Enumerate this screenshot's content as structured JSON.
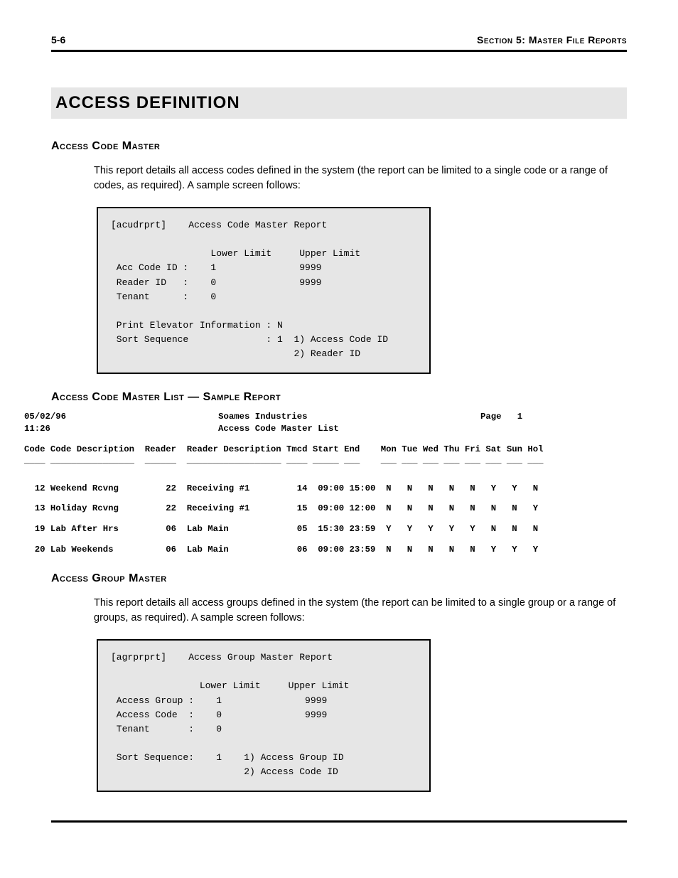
{
  "header": {
    "page_num": "5-6",
    "section_label": "Section 5: Master File Reports"
  },
  "title": "ACCESS DEFINITION",
  "sec1": {
    "heading": "Access Code Master",
    "text": "This report details all access codes defined in the system (the report can be limited to a single code or a range of codes, as required).  A sample screen follows:"
  },
  "screen1": {
    "l1": "[acudrprt]    Access Code Master Report",
    "l2": "",
    "l3": "                  Lower Limit     Upper Limit",
    "l4": " Acc Code ID :    1               9999",
    "l5": " Reader ID   :    0               9999",
    "l6": " Tenant      :    0",
    "l7": "",
    "l8": " Print Elevator Information : N",
    "l9": " Sort Sequence              : 1  1) Access Code ID",
    "l10": "                                 2) Reader ID"
  },
  "sec2": {
    "heading": "Access Code Master List — Sample Report"
  },
  "report": {
    "date": "05/02/96",
    "time": "11:26",
    "company": "Soames Industries",
    "subtitle": "Access Code Master List",
    "page_label": "Page",
    "page_num": "1",
    "columns": "Code Code Description  Reader  Reader Description Tmcd Start End    Mon Tue Wed Thu Fri Sat Sun Hol",
    "underlines": "____ ________________  ______  __________________ ____ _____ ___    ___ ___ ___ ___ ___ ___ ___ ___",
    "row1": "  12 Weekend Rcvng         22  Receiving #1         14  09:00 15:00  N   N   N   N   N   Y   Y   N",
    "row2": "  13 Holiday Rcvng         22  Receiving #1         15  09:00 12:00  N   N   N   N   N   N   N   Y",
    "row3": "  19 Lab After Hrs         06  Lab Main             05  15:30 23:59  Y   Y   Y   Y   Y   N   N   N",
    "row4": "  20 Lab Weekends          06  Lab Main             06  09:00 23:59  N   N   N   N   N   Y   Y   Y"
  },
  "sec3": {
    "heading": "Access Group Master",
    "text": "This report details all access groups defined in the system (the report can be limited to a single group or a range of groups, as required).  A sample screen follows:"
  },
  "screen2": {
    "l1": "[agrprprt]    Access Group Master Report",
    "l2": "",
    "l3": "                Lower Limit     Upper Limit",
    "l4": " Access Group :    1               9999",
    "l5": " Access Code  :    0               9999",
    "l6": " Tenant       :    0",
    "l7": "",
    "l8": " Sort Sequence:    1    1) Access Group ID",
    "l9": "                        2) Access Code ID"
  }
}
